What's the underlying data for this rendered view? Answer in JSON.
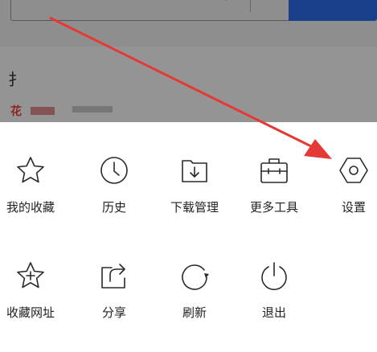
{
  "background_page": {
    "search_button_label": "...",
    "partial_heading_char": "扌",
    "partial_red_char": "花"
  },
  "menu": {
    "items": [
      {
        "label": "我的收藏",
        "icon": "star-icon"
      },
      {
        "label": "历史",
        "icon": "clock-icon"
      },
      {
        "label": "下载管理",
        "icon": "download-folder-icon"
      },
      {
        "label": "更多工具",
        "icon": "toolbox-icon"
      },
      {
        "label": "设置",
        "icon": "settings-hexagon-icon"
      },
      {
        "label": "收藏网址",
        "icon": "star-plus-icon"
      },
      {
        "label": "分享",
        "icon": "share-icon"
      },
      {
        "label": "刷新",
        "icon": "refresh-icon"
      },
      {
        "label": "退出",
        "icon": "power-icon"
      }
    ]
  },
  "annotation": {
    "arrow_color": "#e53935"
  }
}
